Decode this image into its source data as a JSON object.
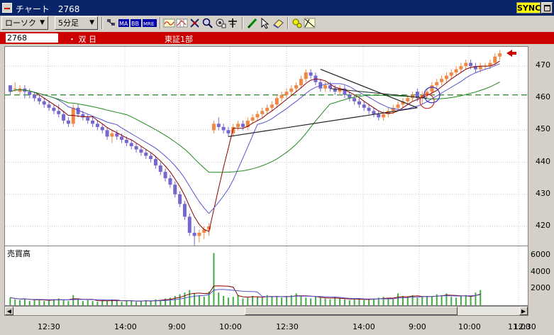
{
  "window": {
    "title": "チャート　2768",
    "sync_label": "SYNC"
  },
  "toolbar": {
    "chart_type": "ローソク",
    "interval": "5分足",
    "buttons": [
      "toggle-icon",
      "ma-icon",
      "bb-icon",
      "mre-icon",
      "wave-icon",
      "grid-icon",
      "compare-icon",
      "zoom-icon",
      "gear-icon",
      "crosshair-icon",
      "pen-icon",
      "pointer-icon",
      "eraser-icon",
      "settings-icon",
      "fib-icon"
    ],
    "ma_label": "MA",
    "bb_label": "BB",
    "mre_label": "MRE"
  },
  "status": {
    "code": "2768",
    "name": "・ 双 日",
    "market": "東証1部"
  },
  "y_axis": {
    "ticks": [
      "470",
      "460",
      "450",
      "440",
      "430",
      "420"
    ]
  },
  "vol_axis": {
    "ticks": [
      "6000",
      "4000",
      "2000"
    ],
    "label": "売買高"
  },
  "x_axis": {
    "ticks": [
      "12:30",
      "14:00",
      "9:00",
      "10:00",
      "12:30",
      "14:00",
      "9:00",
      "10:00",
      "11:00",
      "12:30"
    ]
  },
  "colors": {
    "up": "#ee8844",
    "down": "#7766cc",
    "ma_fast": "#880000",
    "ma_mid": "#5555cc",
    "ma_slow": "#228822",
    "hline": "#228822",
    "marker": "#cc0000"
  },
  "chart_data": {
    "type": "candlestick",
    "ylim": [
      414,
      476
    ],
    "reference_line": 461,
    "candles": [
      [
        464,
        464,
        461,
        462
      ],
      [
        463,
        465,
        462,
        463
      ],
      [
        462,
        464,
        461,
        463
      ],
      [
        463,
        464,
        460,
        462
      ],
      [
        462,
        463,
        460,
        461
      ],
      [
        461,
        462,
        459,
        460
      ],
      [
        460,
        461,
        458,
        459
      ],
      [
        459,
        460,
        457,
        458
      ],
      [
        458,
        459,
        456,
        457
      ],
      [
        457,
        458,
        455,
        456
      ],
      [
        456,
        458,
        454,
        455
      ],
      [
        455,
        456,
        452,
        453
      ],
      [
        453,
        454,
        451,
        452
      ],
      [
        452,
        458,
        451,
        457
      ],
      [
        457,
        458,
        454,
        455
      ],
      [
        455,
        456,
        453,
        454
      ],
      [
        454,
        455,
        452,
        453
      ],
      [
        453,
        454,
        451,
        452
      ],
      [
        452,
        453,
        450,
        451
      ],
      [
        451,
        452,
        449,
        450
      ],
      [
        450,
        451,
        447,
        448
      ],
      [
        448,
        450,
        446,
        449
      ],
      [
        449,
        450,
        447,
        448
      ],
      [
        448,
        449,
        446,
        447
      ],
      [
        447,
        448,
        445,
        446
      ],
      [
        446,
        447,
        444,
        445
      ],
      [
        445,
        446,
        443,
        444
      ],
      [
        444,
        445,
        442,
        443
      ],
      [
        443,
        444,
        441,
        442
      ],
      [
        442,
        443,
        440,
        441
      ],
      [
        441,
        442,
        438,
        439
      ],
      [
        439,
        440,
        436,
        437
      ],
      [
        437,
        438,
        434,
        435
      ],
      [
        435,
        436,
        432,
        433
      ],
      [
        433,
        434,
        429,
        430
      ],
      [
        430,
        431,
        426,
        427
      ],
      [
        427,
        428,
        422,
        423
      ],
      [
        423,
        424,
        417,
        418
      ],
      [
        418,
        420,
        414,
        417
      ],
      [
        417,
        419,
        415,
        418
      ],
      [
        418,
        420,
        416,
        419
      ],
      [
        419,
        421,
        417,
        420
      ],
      [
        450,
        453,
        449,
        452
      ],
      [
        452,
        454,
        450,
        451
      ],
      [
        451,
        452,
        449,
        450
      ],
      [
        450,
        451,
        448,
        449
      ],
      [
        449,
        452,
        448,
        451
      ],
      [
        451,
        453,
        450,
        452
      ],
      [
        452,
        453,
        450,
        451
      ],
      [
        451,
        454,
        450,
        453
      ],
      [
        453,
        455,
        452,
        454
      ],
      [
        454,
        456,
        453,
        455
      ],
      [
        455,
        457,
        454,
        456
      ],
      [
        456,
        458,
        455,
        457
      ],
      [
        457,
        459,
        456,
        458
      ],
      [
        458,
        461,
        457,
        460
      ],
      [
        460,
        462,
        459,
        461
      ],
      [
        461,
        463,
        460,
        462
      ],
      [
        462,
        464,
        461,
        463
      ],
      [
        463,
        465,
        462,
        464
      ],
      [
        464,
        467,
        463,
        466
      ],
      [
        466,
        469,
        465,
        468
      ],
      [
        468,
        469,
        466,
        467
      ],
      [
        467,
        468,
        464,
        465
      ],
      [
        465,
        466,
        462,
        463
      ],
      [
        463,
        465,
        462,
        464
      ],
      [
        464,
        465,
        462,
        463
      ],
      [
        463,
        464,
        461,
        462
      ],
      [
        462,
        464,
        461,
        463
      ],
      [
        463,
        464,
        460,
        461
      ],
      [
        461,
        462,
        459,
        460
      ],
      [
        460,
        461,
        458,
        459
      ],
      [
        459,
        460,
        457,
        458
      ],
      [
        458,
        459,
        456,
        457
      ],
      [
        457,
        458,
        455,
        456
      ],
      [
        456,
        457,
        454,
        455
      ],
      [
        455,
        456,
        453,
        454
      ],
      [
        454,
        456,
        453,
        455
      ],
      [
        455,
        457,
        454,
        456
      ],
      [
        456,
        458,
        455,
        457
      ],
      [
        457,
        459,
        456,
        458
      ],
      [
        458,
        460,
        457,
        459
      ],
      [
        459,
        461,
        458,
        460
      ],
      [
        460,
        462,
        459,
        461
      ],
      [
        462,
        463,
        459,
        460
      ],
      [
        460,
        462,
        458,
        461
      ],
      [
        461,
        463,
        460,
        462
      ],
      [
        462,
        465,
        461,
        464
      ],
      [
        464,
        466,
        463,
        465
      ],
      [
        465,
        467,
        464,
        466
      ],
      [
        466,
        468,
        465,
        467
      ],
      [
        467,
        469,
        466,
        468
      ],
      [
        468,
        470,
        467,
        469
      ],
      [
        469,
        471,
        468,
        470
      ],
      [
        470,
        472,
        469,
        471
      ],
      [
        471,
        472,
        469,
        470
      ],
      [
        470,
        471,
        468,
        469
      ],
      [
        469,
        471,
        468,
        470
      ],
      [
        470,
        471,
        469,
        470
      ],
      [
        470,
        472,
        469,
        471
      ],
      [
        471,
        474,
        470,
        473
      ],
      [
        473,
        475,
        472,
        474
      ]
    ],
    "volume": [
      900,
      700,
      600,
      800,
      500,
      600,
      700,
      500,
      600,
      700,
      800,
      600,
      500,
      1200,
      700,
      500,
      600,
      500,
      400,
      600,
      500,
      700,
      500,
      400,
      600,
      500,
      400,
      500,
      600,
      500,
      700,
      600,
      800,
      900,
      1100,
      1300,
      1500,
      1800,
      1400,
      1200,
      1000,
      1600,
      6200,
      1500,
      1100,
      900,
      1000,
      1200,
      800,
      900,
      1100,
      1000,
      900,
      1200,
      1000,
      1100,
      900,
      1000,
      1200,
      1400,
      1100,
      900,
      800,
      1000,
      900,
      800,
      700,
      900,
      800,
      700,
      600,
      700,
      800,
      600,
      700,
      800,
      900,
      1000,
      800,
      700,
      1400,
      1100,
      1000,
      1200,
      900,
      1000,
      1100,
      1000,
      1300,
      1200,
      1400,
      1000,
      900,
      1100,
      1200,
      1000,
      1500,
      1800
    ]
  }
}
